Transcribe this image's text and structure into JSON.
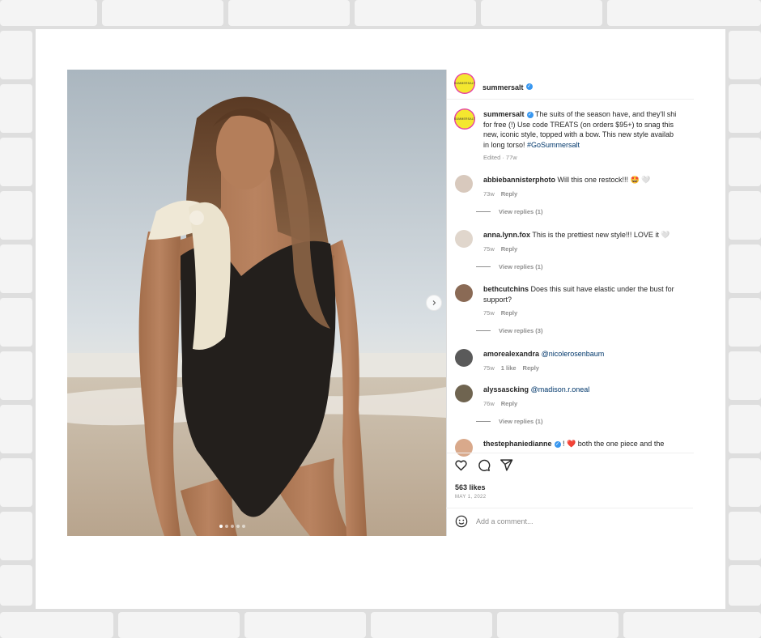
{
  "post": {
    "account": "summersalt",
    "brand_badge": "SUMMERSALT",
    "caption_lines": [
      "The suits of the season have, and they'll shi",
      "for free (!) Use code TREATS (on orders $95+) to snag this",
      "new, iconic style, topped with a bow. This new style availab",
      "in long torso! "
    ],
    "hashtag": "#GoSummersalt",
    "edited": "Edited · 77w",
    "image_alt": "Model in black one-shoulder swimsuit with a cream bow on a beach",
    "carousel": {
      "total": 5,
      "active": 1
    }
  },
  "comments": [
    {
      "user": "abbiebannisterphoto",
      "text": "Will this one restock!!! 🤩 🤍",
      "time": "73w",
      "likes": "",
      "reply": "Reply",
      "view_replies": "View replies (1)"
    },
    {
      "user": "anna.lynn.fox",
      "text": "This is the prettiest new style!!! LOVE it 🤍",
      "time": "75w",
      "likes": "",
      "reply": "Reply",
      "view_replies": "View replies (1)"
    },
    {
      "user": "bethcutchins",
      "text": "Does this suit have elastic under the bust for",
      "text2": "support?",
      "time": "75w",
      "likes": "",
      "reply": "Reply",
      "view_replies": "View replies (3)"
    },
    {
      "user": "amorealexandra",
      "text": "@nicolerosenbaum",
      "time": "75w",
      "likes": "1 like",
      "reply": "Reply",
      "view_replies": ""
    },
    {
      "user": "alyssascking",
      "text": "@madison.r.oneal",
      "time": "76w",
      "likes": "",
      "reply": "Reply",
      "view_replies": "View replies (1)"
    },
    {
      "user": "thestephaniedianne",
      "text": "! ❤️ both the one piece and the",
      "time": "",
      "likes": "",
      "reply": "",
      "view_replies": ""
    }
  ],
  "footer": {
    "likes": "563 likes",
    "date": "MAY 1, 2022",
    "add_comment_placeholder": "Add a comment..."
  },
  "icons": [
    "heart-icon",
    "comment-icon",
    "share-icon",
    "chevron-right-icon",
    "emoji-icon",
    "verified-icon"
  ],
  "colors": {
    "accent": "#3897f0",
    "link": "#00376b",
    "muted": "#8e8e8e",
    "swimsuit": "#231f1c",
    "bow": "#efe8d6"
  }
}
